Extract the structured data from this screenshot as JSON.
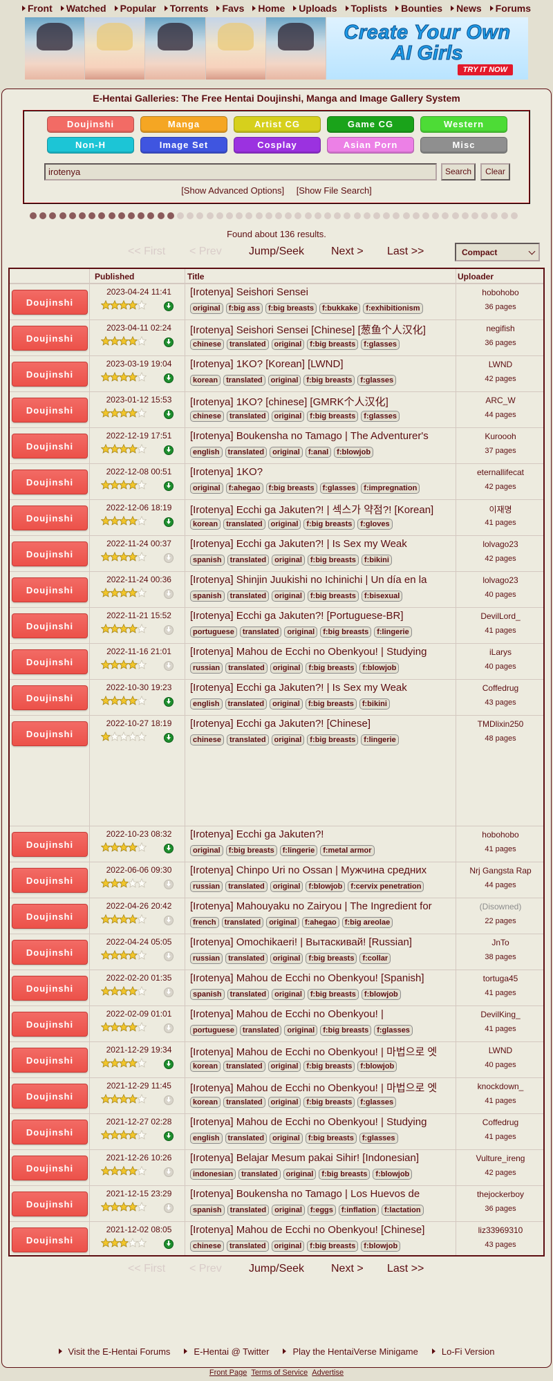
{
  "topnav": [
    "Front",
    "Watched",
    "Popular",
    "Torrents",
    "Favs",
    "Home",
    "Uploads",
    "Toplists",
    "Bounties",
    "News",
    "Forums"
  ],
  "banner": {
    "line1": "Create Your Own",
    "line2": "AI Girls",
    "cta": "TRY IT NOW"
  },
  "site_title": "E-Hentai Galleries: The Free Hentai Doujinshi, Manga and Image Gallery System",
  "categories": [
    {
      "label": "Doujinshi",
      "color": "#f26b65"
    },
    {
      "label": "Manga",
      "color": "#f5a623"
    },
    {
      "label": "Artist CG",
      "color": "#d6d01c"
    },
    {
      "label": "Game CG",
      "color": "#1aa31a"
    },
    {
      "label": "Western",
      "color": "#4ddc36"
    },
    {
      "label": "Non-H",
      "color": "#1cc5d6"
    },
    {
      "label": "Image Set",
      "color": "#3f55e0"
    },
    {
      "label": "Cosplay",
      "color": "#9b32e0"
    },
    {
      "label": "Asian Porn",
      "color": "#ec80e6"
    },
    {
      "label": "Misc",
      "color": "#8f8f8f"
    }
  ],
  "search": {
    "value": "irotenya",
    "search_label": "Search",
    "clear_label": "Clear"
  },
  "search_options": [
    "[Show Advanced Options]",
    "[Show File Search]"
  ],
  "results_text": "Found about 136 results.",
  "pager": {
    "first": "<< First",
    "prev": "< Prev",
    "jump": "Jump/Seek",
    "next": "Next >",
    "last": "Last >>"
  },
  "display_mode": "Compact",
  "headers": {
    "published": "Published",
    "title": "Title",
    "uploader": "Uploader"
  },
  "rows": [
    {
      "category": "Doujinshi",
      "date": "2023-04-24 11:41",
      "rating": 4,
      "torrent": true,
      "title": "[Irotenya] Seishori Sensei",
      "tags": [
        "original",
        "f:big ass",
        "f:big breasts",
        "f:bukkake",
        "f:exhibitionism"
      ],
      "uploader": "hobohobo",
      "pages": "36 pages"
    },
    {
      "category": "Doujinshi",
      "date": "2023-04-11 02:24",
      "rating": 4,
      "torrent": true,
      "title": "[Irotenya] Seishori Sensei [Chinese] [葱鱼个人汉化]",
      "tags": [
        "chinese",
        "translated",
        "original",
        "f:big breasts",
        "f:glasses"
      ],
      "uploader": "negifish",
      "pages": "36 pages"
    },
    {
      "category": "Doujinshi",
      "date": "2023-03-19 19:04",
      "rating": 4,
      "torrent": true,
      "title": "[Irotenya] 1KO? [Korean] [LWND]",
      "tags": [
        "korean",
        "translated",
        "original",
        "f:big breasts",
        "f:glasses"
      ],
      "uploader": "LWND",
      "pages": "42 pages"
    },
    {
      "category": "Doujinshi",
      "date": "2023-01-12 15:53",
      "rating": 4,
      "torrent": true,
      "title": "[Irotenya] 1KO? [chinese] [GMRK个人汉化]",
      "tags": [
        "chinese",
        "translated",
        "original",
        "f:big breasts",
        "f:glasses"
      ],
      "uploader": "ARC_W",
      "pages": "44 pages"
    },
    {
      "category": "Doujinshi",
      "date": "2022-12-19 17:51",
      "rating": 4,
      "torrent": true,
      "title": "[Irotenya] Boukensha no Tamago | The Adventurer's",
      "tags": [
        "english",
        "translated",
        "original",
        "f:anal",
        "f:blowjob"
      ],
      "uploader": "Kuroooh",
      "pages": "37 pages"
    },
    {
      "category": "Doujinshi",
      "date": "2022-12-08 00:51",
      "rating": 4,
      "torrent": true,
      "title": "[Irotenya] 1KO?",
      "tags": [
        "original",
        "f:ahegao",
        "f:big breasts",
        "f:glasses",
        "f:impregnation"
      ],
      "uploader": "eternallifecat",
      "pages": "42 pages"
    },
    {
      "category": "Doujinshi",
      "date": "2022-12-06 18:19",
      "rating": 4,
      "torrent": true,
      "title": "[Irotenya] Ecchi ga Jakuten?! | 섹스가 약점?! [Korean]",
      "tags": [
        "korean",
        "translated",
        "original",
        "f:big breasts",
        "f:gloves"
      ],
      "uploader": "이재명",
      "pages": "41 pages"
    },
    {
      "category": "Doujinshi",
      "date": "2022-11-24 00:37",
      "rating": 4,
      "torrent": false,
      "title": "[Irotenya] Ecchi ga Jakuten?! | Is Sex my Weak",
      "tags": [
        "spanish",
        "translated",
        "original",
        "f:big breasts",
        "f:bikini"
      ],
      "uploader": "lolvago23",
      "pages": "42 pages"
    },
    {
      "category": "Doujinshi",
      "date": "2022-11-24 00:36",
      "rating": 4,
      "torrent": false,
      "title": "[Irotenya] Shinjin Juukishi no Ichinichi | Un día en la",
      "tags": [
        "spanish",
        "translated",
        "original",
        "f:big breasts",
        "f:bisexual"
      ],
      "uploader": "lolvago23",
      "pages": "40 pages"
    },
    {
      "category": "Doujinshi",
      "date": "2022-11-21 15:52",
      "rating": 4,
      "torrent": false,
      "title": "[Irotenya] Ecchi ga Jakuten?! [Portuguese-BR]",
      "tags": [
        "portuguese",
        "translated",
        "original",
        "f:big breasts",
        "f:lingerie"
      ],
      "uploader": "DevilLord_",
      "pages": "41 pages"
    },
    {
      "category": "Doujinshi",
      "date": "2022-11-16 21:01",
      "rating": 4,
      "torrent": false,
      "title": "[Irotenya] Mahou de Ecchi no Obenkyou! | Studying",
      "tags": [
        "russian",
        "translated",
        "original",
        "f:big breasts",
        "f:blowjob"
      ],
      "uploader": "iLarys",
      "pages": "40 pages"
    },
    {
      "category": "Doujinshi",
      "date": "2022-10-30 19:23",
      "rating": 4,
      "torrent": true,
      "title": "[Irotenya] Ecchi ga Jakuten?! | Is Sex my Weak",
      "tags": [
        "english",
        "translated",
        "original",
        "f:big breasts",
        "f:bikini"
      ],
      "uploader": "Coffedrug",
      "pages": "43 pages"
    },
    {
      "category": "Doujinshi",
      "date": "2022-10-27 18:19",
      "rating": 1,
      "torrent": true,
      "title": "[Irotenya] Ecchi ga Jakuten?! [Chinese]",
      "tags": [
        "chinese",
        "translated",
        "original",
        "f:big breasts",
        "f:lingerie"
      ],
      "uploader": "TMDlixin250",
      "pages": "48 pages"
    },
    {
      "category": "Doujinshi",
      "date": "2022-10-23 08:32",
      "rating": 4,
      "torrent": true,
      "title": "[Irotenya] Ecchi ga Jakuten?!",
      "tags": [
        "original",
        "f:big breasts",
        "f:lingerie",
        "f:metal armor"
      ],
      "uploader": "hobohobo",
      "pages": "41 pages"
    },
    {
      "category": "Doujinshi",
      "date": "2022-06-06 09:30",
      "rating": 3,
      "torrent": false,
      "title": "[Irotenya] Chinpo Uri no Ossan | Мужчина средних",
      "tags": [
        "russian",
        "translated",
        "original",
        "f:blowjob",
        "f:cervix penetration"
      ],
      "uploader": "Nrj Gangsta Rap",
      "pages": "44 pages"
    },
    {
      "category": "Doujinshi",
      "date": "2022-04-26 20:42",
      "rating": 4,
      "torrent": false,
      "title": "[Irotenya] Mahouyaku no Zairyou | The Ingredient for",
      "tags": [
        "french",
        "translated",
        "original",
        "f:ahegao",
        "f:big areolae"
      ],
      "uploader": "(Disowned)",
      "pages": "22 pages",
      "disowned": true
    },
    {
      "category": "Doujinshi",
      "date": "2022-04-24 05:05",
      "rating": 4,
      "torrent": false,
      "title": "[Irotenya] Omochikaeri! | Вытаскивай! [Russian]",
      "tags": [
        "russian",
        "translated",
        "original",
        "f:big breasts",
        "f:collar"
      ],
      "uploader": "JnTo",
      "pages": "38 pages"
    },
    {
      "category": "Doujinshi",
      "date": "2022-02-20 01:35",
      "rating": 4,
      "torrent": false,
      "title": "[Irotenya] Mahou de Ecchi no Obenkyou! [Spanish]",
      "tags": [
        "spanish",
        "translated",
        "original",
        "f:big breasts",
        "f:blowjob"
      ],
      "uploader": "tortuga45",
      "pages": "41 pages"
    },
    {
      "category": "Doujinshi",
      "date": "2022-02-09 01:01",
      "rating": 4,
      "torrent": false,
      "title": "[Irotenya] Mahou de Ecchi no Obenkyou! |",
      "tags": [
        "portuguese",
        "translated",
        "original",
        "f:big breasts",
        "f:glasses"
      ],
      "uploader": "DevilKing_",
      "pages": "41 pages"
    },
    {
      "category": "Doujinshi",
      "date": "2021-12-29 19:34",
      "rating": 4,
      "torrent": true,
      "title": "[Irotenya] Mahou de Ecchi no Obenkyou! | 마법으로 엣",
      "tags": [
        "korean",
        "translated",
        "original",
        "f:big breasts",
        "f:blowjob"
      ],
      "uploader": "LWND",
      "pages": "40 pages"
    },
    {
      "category": "Doujinshi",
      "date": "2021-12-29 11:45",
      "rating": 4,
      "torrent": false,
      "title": "[Irotenya] Mahou de Ecchi no Obenkyou! | 마법으로 엣",
      "tags": [
        "korean",
        "translated",
        "original",
        "f:big breasts",
        "f:glasses"
      ],
      "uploader": "knockdown_",
      "pages": "41 pages"
    },
    {
      "category": "Doujinshi",
      "date": "2021-12-27 02:28",
      "rating": 4,
      "torrent": true,
      "title": "[Irotenya] Mahou de Ecchi no Obenkyou! | Studying",
      "tags": [
        "english",
        "translated",
        "original",
        "f:big breasts",
        "f:glasses"
      ],
      "uploader": "Coffedrug",
      "pages": "41 pages"
    },
    {
      "category": "Doujinshi",
      "date": "2021-12-26 10:26",
      "rating": 4,
      "torrent": false,
      "title": "[Irotenya] Belajar Mesum pakai Sihir! [Indonesian]",
      "tags": [
        "indonesian",
        "translated",
        "original",
        "f:big breasts",
        "f:blowjob"
      ],
      "uploader": "Vulture_ireng",
      "pages": "42 pages"
    },
    {
      "category": "Doujinshi",
      "date": "2021-12-15 23:29",
      "rating": 4,
      "torrent": false,
      "title": "[Irotenya] Boukensha no Tamago | Los Huevos de",
      "tags": [
        "spanish",
        "translated",
        "original",
        "f:eggs",
        "f:inflation",
        "f:lactation"
      ],
      "uploader": "thejockerboy",
      "pages": "36 pages"
    },
    {
      "category": "Doujinshi",
      "date": "2021-12-02 08:05",
      "rating": 3,
      "torrent": true,
      "title": "[Irotenya] Mahou de Ecchi no Obenkyou! [Chinese]",
      "tags": [
        "chinese",
        "translated",
        "original",
        "f:big breasts",
        "f:blowjob"
      ],
      "uploader": "liz33969310",
      "pages": "43 pages"
    }
  ],
  "footer_links": [
    "Visit the E-Hentai Forums",
    "E-Hentai @ Twitter",
    "Play the HentaiVerse Minigame",
    "Lo-Fi Version"
  ],
  "bottom_links": [
    "Front Page",
    "Terms of Service",
    "Advertise"
  ]
}
